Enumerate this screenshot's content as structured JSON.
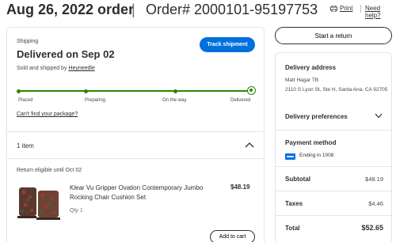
{
  "header": {
    "order_date": "Aug 26, 2022 order",
    "separator": "|",
    "order_number": "Order# 2000101-95197753",
    "print_label": "Print",
    "help_label": "Need help?"
  },
  "shipment": {
    "section_label": "Shipping",
    "status": "Delivered on Sep 02",
    "sold_prefix": "Sold and shipped by ",
    "seller": "Heyneedle",
    "track_button": "Track shipment",
    "progress_steps": [
      "Placed",
      "Preparing",
      "On the way",
      "Delivered"
    ],
    "current_step": "Delivered",
    "cant_find_link": "Can't find your package?"
  },
  "items": {
    "count_label": "1 item",
    "return_eligibility": "Return eligible until Oct 02",
    "list": [
      {
        "title": "Klear Vu Gripper Ovation Contemporary Jumbo Rocking Chair Cushion Set",
        "qty": "Qty 1",
        "price": "$48.19",
        "add_to_cart": "Add to cart"
      }
    ]
  },
  "actions": {
    "start_return": "Start a return"
  },
  "sidebar": {
    "delivery_address_title": "Delivery address",
    "address_name": "Matt Hagar TB",
    "address_line": "2110 S Lyon St, Ste H, Santa Ana, CA 92705",
    "delivery_preferences": "Delivery preferences",
    "payment_method_title": "Payment method",
    "payment_ending": "Ending in 1008",
    "subtotal_label": "Subtotal",
    "subtotal_value": "$48.19",
    "taxes_label": "Taxes",
    "taxes_value": "$4.46",
    "total_label": "Total",
    "total_value": "$52.65"
  },
  "colors": {
    "primary_blue": "#0071dc",
    "success_green": "#2a8703",
    "text": "#2e2f32",
    "border": "#e3e4e5"
  },
  "icons": [
    "print-icon",
    "chevron-up-icon",
    "chevron-down-icon",
    "card-icon"
  ]
}
